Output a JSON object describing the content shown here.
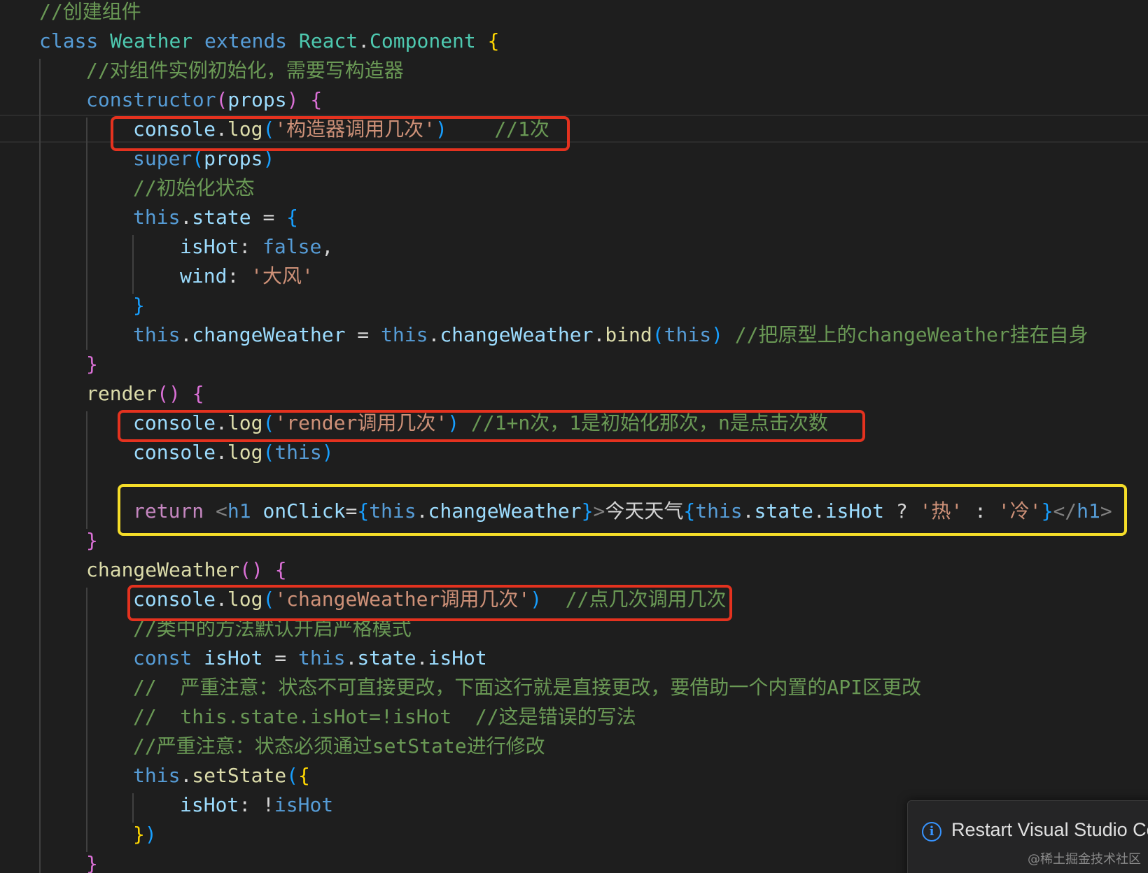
{
  "editor": {
    "lines": [
      {
        "indent": 0,
        "tokens": [
          {
            "t": "//创建组件",
            "c": "cmt"
          }
        ]
      },
      {
        "indent": 0,
        "tokens": [
          {
            "t": "class ",
            "c": "kw"
          },
          {
            "t": "Weather",
            "c": "cls"
          },
          {
            "t": " extends ",
            "c": "kw"
          },
          {
            "t": "React",
            "c": "cls"
          },
          {
            "t": ".",
            "c": "op"
          },
          {
            "t": "Component",
            "c": "cls"
          },
          {
            "t": " ",
            "c": "op"
          },
          {
            "t": "{",
            "c": "b1"
          }
        ]
      },
      {
        "indent": 1,
        "tokens": [
          {
            "t": "//对组件实例初始化，需要写构造器",
            "c": "cmt"
          }
        ]
      },
      {
        "indent": 1,
        "tokens": [
          {
            "t": "constructor",
            "c": "kw"
          },
          {
            "t": "(",
            "c": "b2"
          },
          {
            "t": "props",
            "c": "var"
          },
          {
            "t": ")",
            "c": "b2"
          },
          {
            "t": " ",
            "c": "op"
          },
          {
            "t": "{",
            "c": "b2"
          }
        ]
      },
      {
        "indent": 2,
        "tokens": [
          {
            "t": "console",
            "c": "var"
          },
          {
            "t": ".",
            "c": "op"
          },
          {
            "t": "log",
            "c": "fn"
          },
          {
            "t": "(",
            "c": "b3"
          },
          {
            "t": "'构造器调用几次'",
            "c": "str"
          },
          {
            "t": ")",
            "c": "b3"
          },
          {
            "t": "    ",
            "c": "op"
          },
          {
            "t": "//1次",
            "c": "cmt"
          }
        ]
      },
      {
        "indent": 2,
        "tokens": [
          {
            "t": "super",
            "c": "kw"
          },
          {
            "t": "(",
            "c": "b3"
          },
          {
            "t": "props",
            "c": "var"
          },
          {
            "t": ")",
            "c": "b3"
          }
        ]
      },
      {
        "indent": 2,
        "tokens": [
          {
            "t": "//初始化状态",
            "c": "cmt"
          }
        ]
      },
      {
        "indent": 2,
        "tokens": [
          {
            "t": "this",
            "c": "kw"
          },
          {
            "t": ".",
            "c": "op"
          },
          {
            "t": "state",
            "c": "var"
          },
          {
            "t": " = ",
            "c": "op"
          },
          {
            "t": "{",
            "c": "b3"
          }
        ]
      },
      {
        "indent": 3,
        "tokens": [
          {
            "t": "isHot",
            "c": "var"
          },
          {
            "t": ": ",
            "c": "op"
          },
          {
            "t": "false",
            "c": "kw"
          },
          {
            "t": ",",
            "c": "op"
          }
        ]
      },
      {
        "indent": 3,
        "tokens": [
          {
            "t": "wind",
            "c": "var"
          },
          {
            "t": ": ",
            "c": "op"
          },
          {
            "t": "'大风'",
            "c": "str"
          }
        ]
      },
      {
        "indent": 2,
        "tokens": [
          {
            "t": "}",
            "c": "b3"
          }
        ]
      },
      {
        "indent": 2,
        "tokens": [
          {
            "t": "this",
            "c": "kw"
          },
          {
            "t": ".",
            "c": "op"
          },
          {
            "t": "changeWeather",
            "c": "var"
          },
          {
            "t": " = ",
            "c": "op"
          },
          {
            "t": "this",
            "c": "kw"
          },
          {
            "t": ".",
            "c": "op"
          },
          {
            "t": "changeWeather",
            "c": "var"
          },
          {
            "t": ".",
            "c": "op"
          },
          {
            "t": "bind",
            "c": "fn"
          },
          {
            "t": "(",
            "c": "b3"
          },
          {
            "t": "this",
            "c": "kw"
          },
          {
            "t": ")",
            "c": "b3"
          },
          {
            "t": " ",
            "c": "op"
          },
          {
            "t": "//把原型上的changeWeather挂在自身",
            "c": "cmt"
          }
        ]
      },
      {
        "indent": 1,
        "tokens": [
          {
            "t": "}",
            "c": "b2"
          }
        ]
      },
      {
        "indent": 1,
        "tokens": [
          {
            "t": "render",
            "c": "fn"
          },
          {
            "t": "(",
            "c": "b2"
          },
          {
            "t": ")",
            "c": "b2"
          },
          {
            "t": " ",
            "c": "op"
          },
          {
            "t": "{",
            "c": "b2"
          }
        ]
      },
      {
        "indent": 2,
        "tokens": [
          {
            "t": "console",
            "c": "var"
          },
          {
            "t": ".",
            "c": "op"
          },
          {
            "t": "log",
            "c": "fn"
          },
          {
            "t": "(",
            "c": "b3"
          },
          {
            "t": "'render调用几次'",
            "c": "str"
          },
          {
            "t": ")",
            "c": "b3"
          },
          {
            "t": " ",
            "c": "op"
          },
          {
            "t": "//1+n次，1是初始化那次，n是点击次数",
            "c": "cmt"
          }
        ]
      },
      {
        "indent": 2,
        "tokens": [
          {
            "t": "console",
            "c": "var"
          },
          {
            "t": ".",
            "c": "op"
          },
          {
            "t": "log",
            "c": "fn"
          },
          {
            "t": "(",
            "c": "b3"
          },
          {
            "t": "this",
            "c": "kw"
          },
          {
            "t": ")",
            "c": "b3"
          }
        ]
      },
      {
        "indent": 2,
        "tokens": []
      },
      {
        "indent": 2,
        "tokens": [
          {
            "t": "return",
            "c": "ctl"
          },
          {
            "t": " ",
            "c": "op"
          },
          {
            "t": "<",
            "c": "tagp"
          },
          {
            "t": "h1",
            "c": "tag"
          },
          {
            "t": " ",
            "c": "op"
          },
          {
            "t": "onClick",
            "c": "attr"
          },
          {
            "t": "=",
            "c": "op"
          },
          {
            "t": "{",
            "c": "b3"
          },
          {
            "t": "this",
            "c": "kw"
          },
          {
            "t": ".",
            "c": "op"
          },
          {
            "t": "changeWeather",
            "c": "var"
          },
          {
            "t": "}",
            "c": "b3"
          },
          {
            "t": ">",
            "c": "tagp"
          },
          {
            "t": "今天天气",
            "c": "plain"
          },
          {
            "t": "{",
            "c": "b3"
          },
          {
            "t": "this",
            "c": "kw"
          },
          {
            "t": ".",
            "c": "op"
          },
          {
            "t": "state",
            "c": "var"
          },
          {
            "t": ".",
            "c": "op"
          },
          {
            "t": "isHot",
            "c": "var"
          },
          {
            "t": " ? ",
            "c": "op"
          },
          {
            "t": "'热'",
            "c": "str"
          },
          {
            "t": " : ",
            "c": "op"
          },
          {
            "t": "'冷'",
            "c": "str"
          },
          {
            "t": "}",
            "c": "b3"
          },
          {
            "t": "</",
            "c": "tagp"
          },
          {
            "t": "h1",
            "c": "tag"
          },
          {
            "t": ">",
            "c": "tagp"
          }
        ]
      },
      {
        "indent": 1,
        "tokens": [
          {
            "t": "}",
            "c": "b2"
          }
        ]
      },
      {
        "indent": 1,
        "tokens": [
          {
            "t": "changeWeather",
            "c": "fn"
          },
          {
            "t": "(",
            "c": "b2"
          },
          {
            "t": ")",
            "c": "b2"
          },
          {
            "t": " ",
            "c": "op"
          },
          {
            "t": "{",
            "c": "b2"
          }
        ]
      },
      {
        "indent": 2,
        "tokens": [
          {
            "t": "console",
            "c": "var"
          },
          {
            "t": ".",
            "c": "op"
          },
          {
            "t": "log",
            "c": "fn"
          },
          {
            "t": "(",
            "c": "b3"
          },
          {
            "t": "'changeWeather调用几次'",
            "c": "str"
          },
          {
            "t": ")",
            "c": "b3"
          },
          {
            "t": "  ",
            "c": "op"
          },
          {
            "t": "//点几次调用几次",
            "c": "cmt"
          }
        ]
      },
      {
        "indent": 2,
        "tokens": [
          {
            "t": "//类中的方法默认开启严格模式",
            "c": "cmt"
          }
        ]
      },
      {
        "indent": 2,
        "tokens": [
          {
            "t": "const",
            "c": "kw"
          },
          {
            "t": " ",
            "c": "op"
          },
          {
            "t": "isHot",
            "c": "var"
          },
          {
            "t": " = ",
            "c": "op"
          },
          {
            "t": "this",
            "c": "kw"
          },
          {
            "t": ".",
            "c": "op"
          },
          {
            "t": "state",
            "c": "var"
          },
          {
            "t": ".",
            "c": "op"
          },
          {
            "t": "isHot",
            "c": "var"
          }
        ]
      },
      {
        "indent": 2,
        "tokens": [
          {
            "t": "//  严重注意：状态不可直接更改，下面这行就是直接更改，要借助一个内置的API区更改",
            "c": "cmt"
          }
        ]
      },
      {
        "indent": 2,
        "tokens": [
          {
            "t": "//  this.state.isHot=!isHot  //这是错误的写法",
            "c": "cmt"
          }
        ]
      },
      {
        "indent": 2,
        "tokens": [
          {
            "t": "//严重注意：状态必须通过setState进行修改",
            "c": "cmt"
          }
        ]
      },
      {
        "indent": 2,
        "tokens": [
          {
            "t": "this",
            "c": "kw"
          },
          {
            "t": ".",
            "c": "op"
          },
          {
            "t": "setState",
            "c": "fn"
          },
          {
            "t": "(",
            "c": "b3"
          },
          {
            "t": "{",
            "c": "b1"
          }
        ]
      },
      {
        "indent": 3,
        "tokens": [
          {
            "t": "isHot",
            "c": "var"
          },
          {
            "t": ": ",
            "c": "op"
          },
          {
            "t": "!",
            "c": "op"
          },
          {
            "t": "isHot",
            "c": "kw"
          }
        ]
      },
      {
        "indent": 2,
        "tokens": [
          {
            "t": "}",
            "c": "b1"
          },
          {
            "t": ")",
            "c": "b3"
          }
        ]
      },
      {
        "indent": 1,
        "tokens": [
          {
            "t": "}",
            "c": "b2"
          }
        ]
      }
    ]
  },
  "notification": {
    "message": "Restart Visual Studio Co",
    "icon": "info-icon"
  },
  "watermark": "@稀土掘金技术社区",
  "colors": {
    "background": "#1e1e1e",
    "highlight_red": "#e4321f",
    "highlight_yellow": "#f5dd29",
    "notification_icon": "#3794ff"
  }
}
